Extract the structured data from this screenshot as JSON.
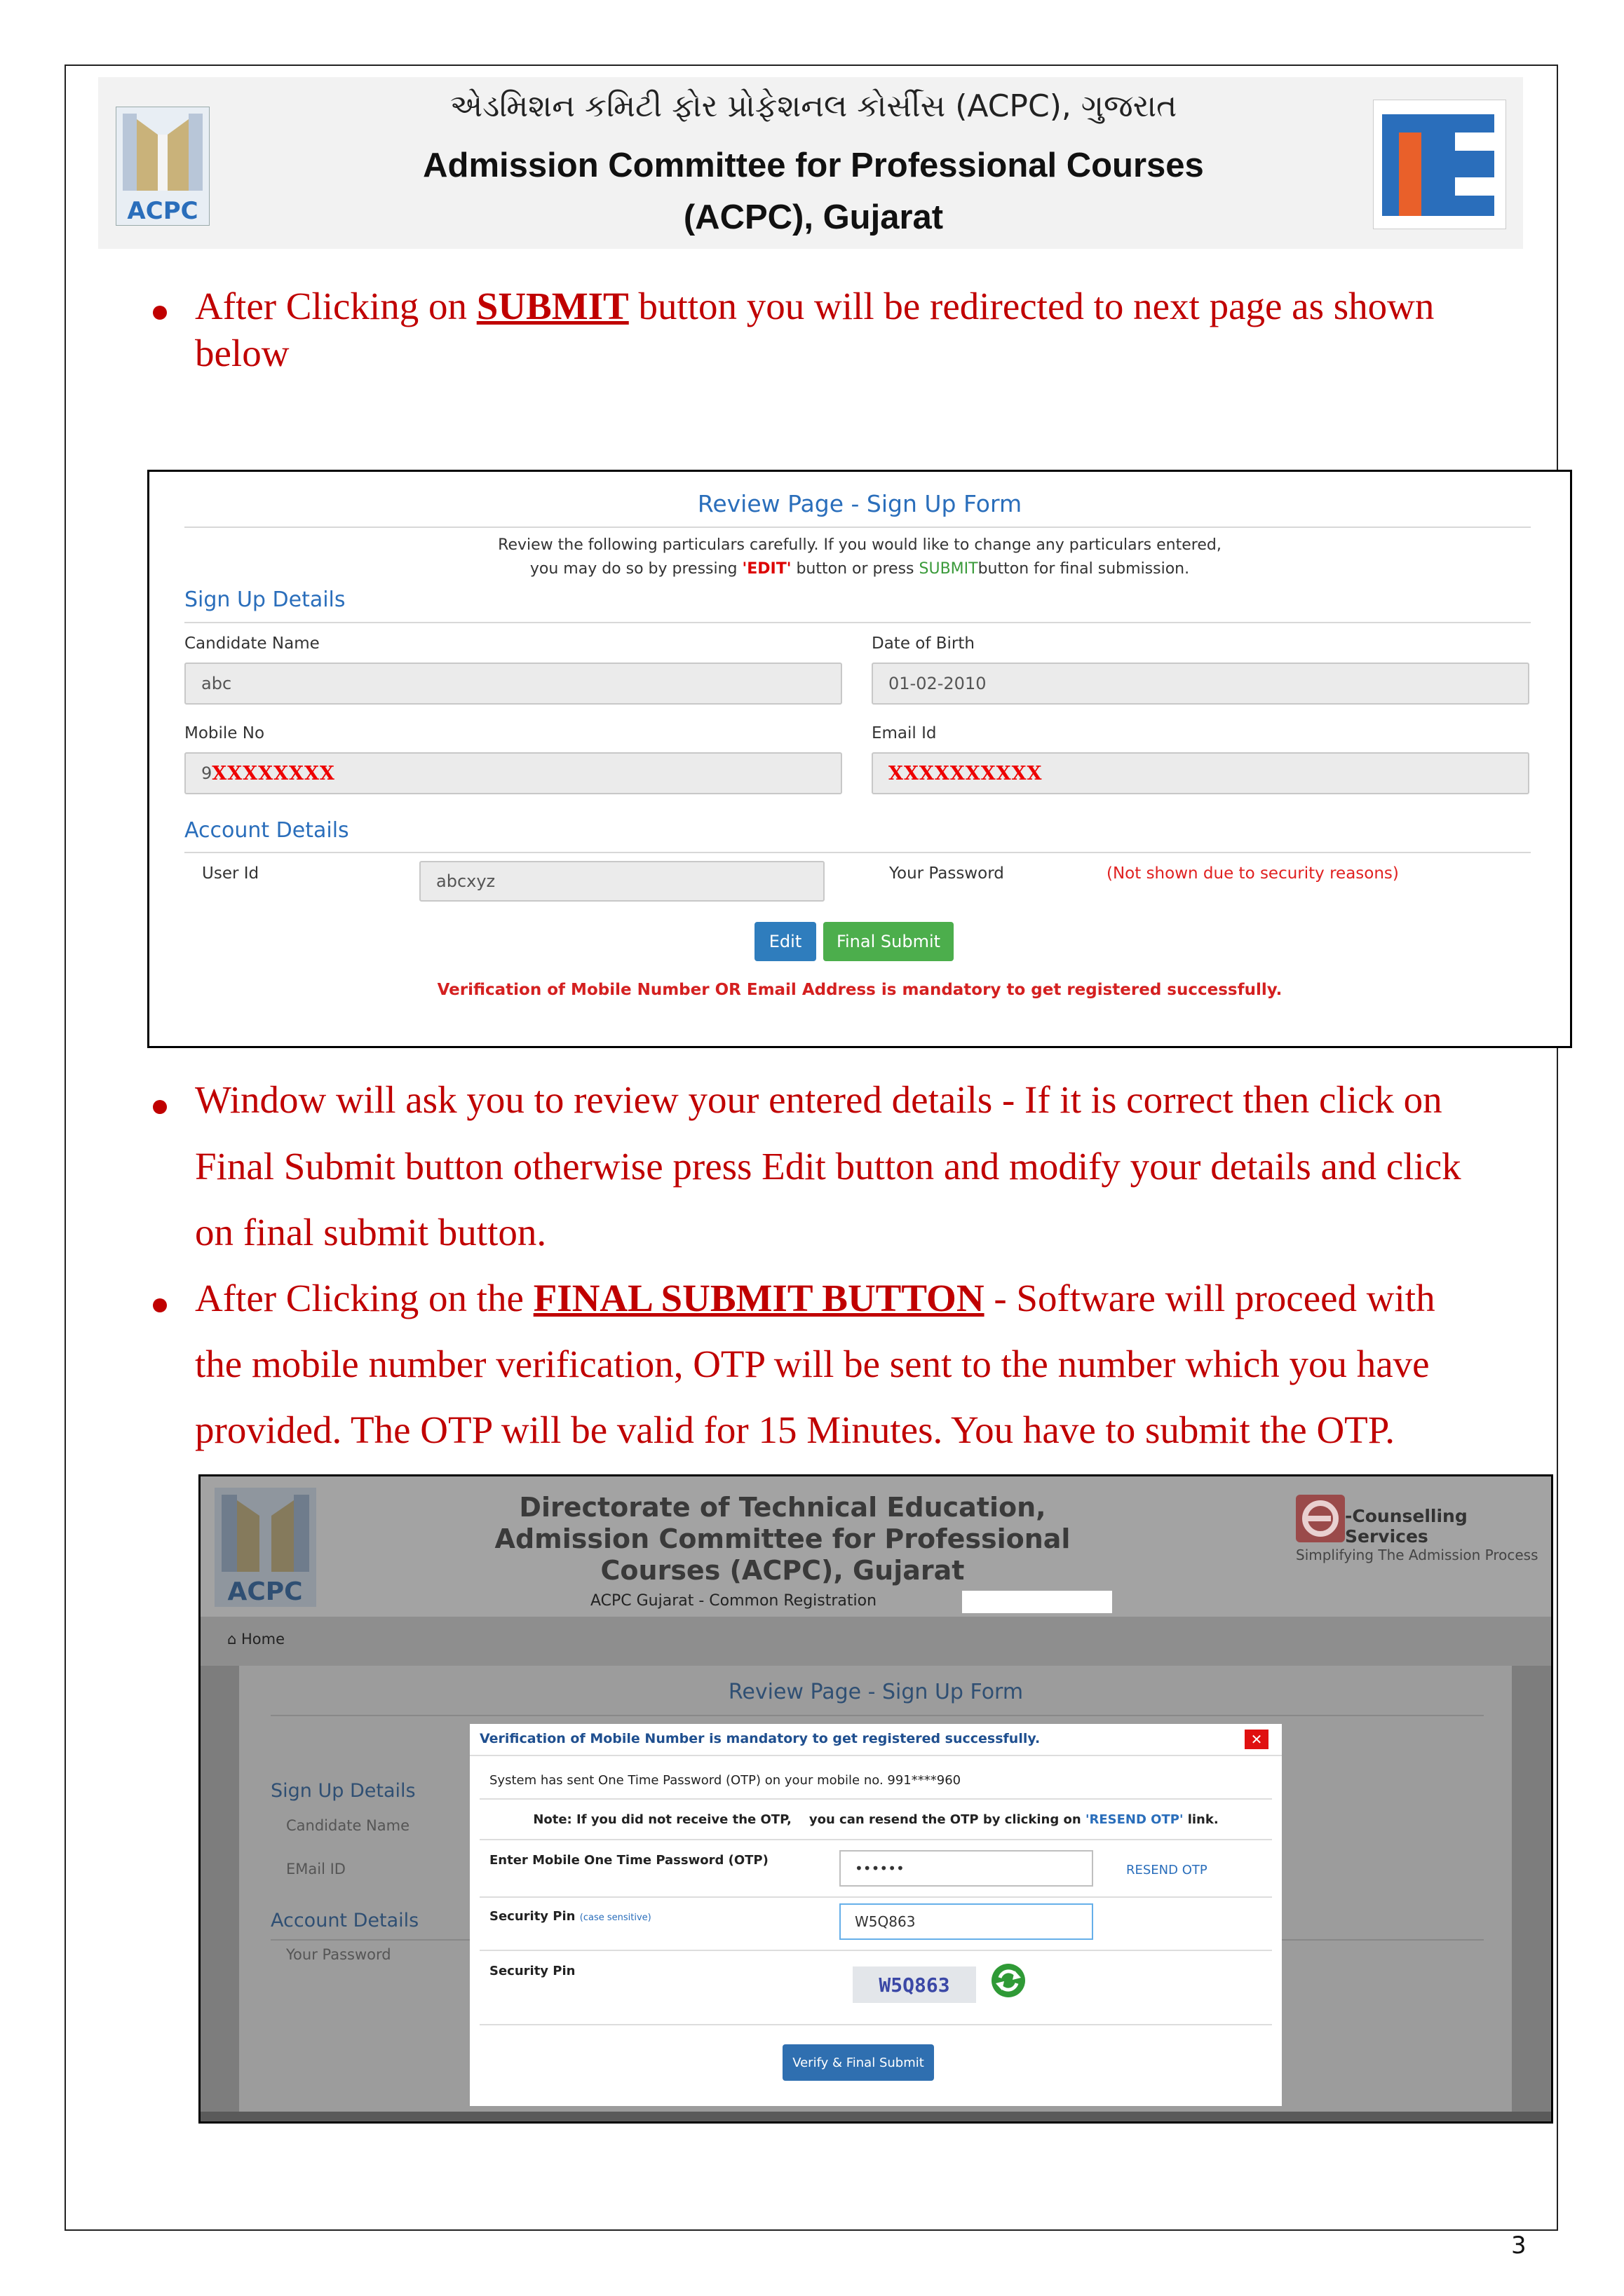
{
  "header": {
    "gujarati_title": "એડમિશન કમિટી ફોર પ્રોફેશનલ કોર્સીસ (ACPC), ગુજરાત",
    "english_title_line1": "Admission Committee for Professional Courses",
    "english_title_line2": "(ACPC), Gujarat",
    "left_logo_text": "ACPC",
    "right_logo_text": "TE"
  },
  "bullet1": {
    "before": "After Clicking on ",
    "emph": "SUBMIT",
    "after": " button you will be redirected to next page as shown",
    "line2": "below"
  },
  "review_form": {
    "title": "Review Page - Sign Up Form",
    "instruction_line1": "Review the following particulars carefully. If you would like to change any particulars entered,",
    "instruction_line2_a": "you may do so by pressing ",
    "instruction_edit": "'EDIT'",
    "instruction_line2_b": " button or press ",
    "instruction_submit": "SUBMIT",
    "instruction_line2_c": "button for final submission.",
    "signup_heading": "Sign Up Details",
    "candidate_name_label": "Candidate Name",
    "candidate_name_value": "abc",
    "dob_label": "Date of Birth",
    "dob_value": "01-02-2010",
    "mobile_label": "Mobile No",
    "mobile_prefix": "9",
    "mobile_redacted": "XXXXXXXX",
    "email_label": "Email Id",
    "email_redacted": "XXXXXXXXXX",
    "account_heading": "Account Details",
    "userid_label": "User Id",
    "userid_value": "abcxyz",
    "password_label": "Your Password",
    "password_note": "(Not shown due to security reasons)",
    "edit_button": "Edit",
    "final_submit_button": "Final Submit",
    "verification_note": "Verification of Mobile Number OR Email Address is mandatory to get registered successfully."
  },
  "bullet2": {
    "line1": "Window will ask you to review your entered details - If it is correct then click on",
    "line2": "Final Submit button otherwise press Edit button and modify your details and click",
    "line3": "on final submit button."
  },
  "bullet3": {
    "before": "After Clicking on the ",
    "emph": "FINAL SUBMIT BUTTON",
    "after": " - Software will proceed with",
    "line2": "the mobile number verification, OTP will be sent to the number which you have",
    "line3": "provided. The OTP will be valid for 15 Minutes. You have to submit the OTP."
  },
  "portal": {
    "title_line1": "Directorate of Technical Education,",
    "title_line2": "Admission Committee for Professional",
    "title_line3": "Courses (ACPC), Gujarat",
    "subtitle": "ACPC Gujarat - Common Registration",
    "logo_left": "ACPC",
    "brand_name": "-Counselling Services",
    "brand_tagline": "Simplifying The Admission Process",
    "nav_home": "Home",
    "bg_title": "Review Page - Sign Up Form",
    "bg_signup": "Sign Up Details",
    "bg_candidate": "Candidate Name",
    "bg_email": "EMail ID",
    "bg_account": "Account Details",
    "bg_password": "Your Password"
  },
  "otp_modal": {
    "header": "Verification of Mobile Number is mandatory to get registered successfully.",
    "close": "✕",
    "sent_text": "System has sent One Time Password (OTP) on your mobile no. 991****960",
    "note_a": "Note: If you did not receive the OTP,    you can resend the OTP by clicking on ",
    "note_link": "'RESEND OTP'",
    "note_b": " link.",
    "otp_label": "Enter Mobile One Time Password (OTP)",
    "otp_value": "••••••",
    "resend": "RESEND OTP",
    "pin_label": "Security Pin",
    "pin_case": "(case sensitive)",
    "pin_value": "W5Q863",
    "captcha_label": "Security Pin",
    "captcha_text": "W5Q863",
    "verify_button": "Verify & Final Submit"
  },
  "page_number": "3"
}
